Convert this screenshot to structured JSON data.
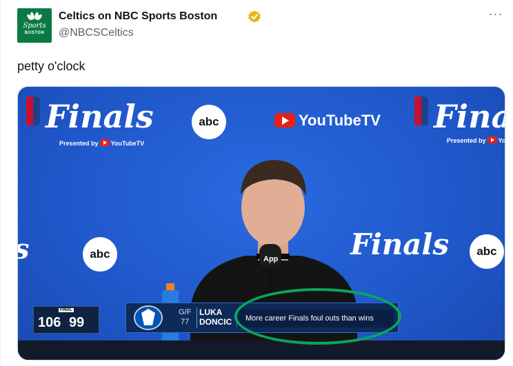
{
  "author": {
    "display_name": "Celtics on NBC Sports Boston",
    "handle": "@NBCSCeltics",
    "verified_icon": "gold-verified-badge-icon",
    "avatar_text_line1": "Sports",
    "avatar_text_line2": "BOSTON"
  },
  "more_menu_label": "···",
  "tweet_text": "petty o'clock",
  "media": {
    "finals_word": "Finals",
    "presented_by": "Presented by",
    "youtube_tv": "YouTubeTV",
    "abc_label": "abc",
    "nba_label": "NBA",
    "mic_label": "App",
    "score_bug": {
      "status": "FINAL",
      "away_score": "106",
      "home_score": "99"
    },
    "lower_third": {
      "position": "G/F",
      "number": "77",
      "first_name": "LUKA",
      "last_name": "DONCIC",
      "stat_line": "More career Finals foul outs than wins"
    },
    "colors": {
      "backdrop": "#1f57c9",
      "highlight_oval": "#0aa65a",
      "nbc_green": "#0a7a43"
    }
  }
}
